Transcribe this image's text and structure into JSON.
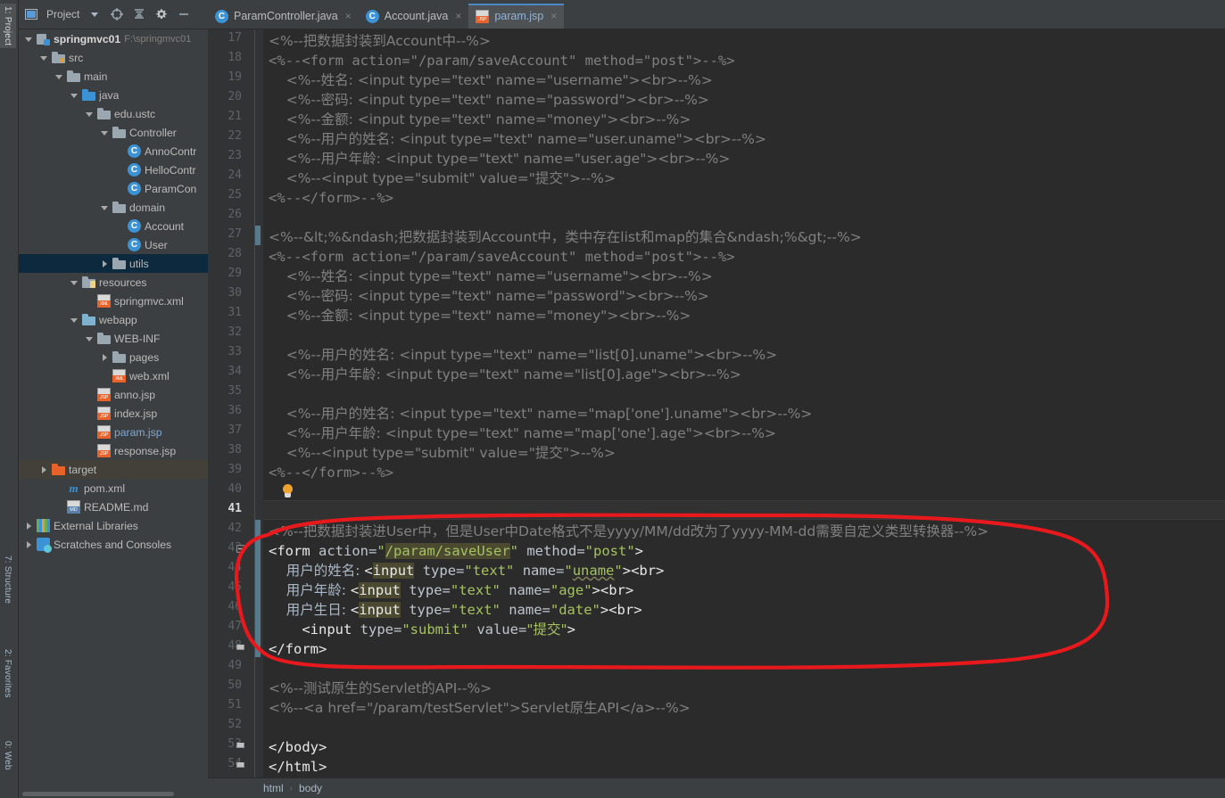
{
  "toolstrip": {
    "items": [
      {
        "label": "1: Project",
        "active": true
      },
      {
        "label": "7: Structure",
        "active": false
      },
      {
        "label": "2: Favorites",
        "active": false
      },
      {
        "label": "0: Web",
        "active": false
      }
    ]
  },
  "project_toolbar": {
    "title": "Project",
    "icons": [
      "chevron-down-icon",
      "locate-target-icon",
      "collapse-all-icon",
      "settings-gear-icon",
      "minimize-icon"
    ]
  },
  "tabs": [
    {
      "label": "ParamController.java",
      "icon": "java-class-icon",
      "active": false,
      "close": "×"
    },
    {
      "label": "Account.java",
      "icon": "java-class-icon",
      "active": false,
      "close": "×"
    },
    {
      "label": "param.jsp",
      "icon": "jsp-file-icon",
      "active": true,
      "close": "×"
    }
  ],
  "tree": [
    {
      "indent": 0,
      "arrow": "down",
      "icon": "module-icon",
      "label": "springmvc01",
      "bold": true,
      "suffix": "F:\\springmvc01",
      "selected": ""
    },
    {
      "indent": 1,
      "arrow": "down",
      "icon": "folder-src",
      "label": "src",
      "bold": false,
      "suffix": "",
      "selected": ""
    },
    {
      "indent": 2,
      "arrow": "down",
      "icon": "folder",
      "label": "main",
      "bold": false,
      "suffix": "",
      "selected": ""
    },
    {
      "indent": 3,
      "arrow": "down",
      "icon": "folder-blue",
      "label": "java",
      "bold": false,
      "suffix": "",
      "selected": ""
    },
    {
      "indent": 4,
      "arrow": "down",
      "icon": "package-icon",
      "label": "edu.ustc",
      "bold": false,
      "suffix": "",
      "selected": ""
    },
    {
      "indent": 5,
      "arrow": "down",
      "icon": "package-icon",
      "label": "Controller",
      "bold": false,
      "suffix": "",
      "selected": ""
    },
    {
      "indent": 6,
      "arrow": "none",
      "icon": "java-class-icon",
      "label": "AnnoContr",
      "bold": false,
      "suffix": "",
      "selected": ""
    },
    {
      "indent": 6,
      "arrow": "none",
      "icon": "java-class-icon",
      "label": "HelloContr",
      "bold": false,
      "suffix": "",
      "selected": ""
    },
    {
      "indent": 6,
      "arrow": "none",
      "icon": "java-class-icon",
      "label": "ParamCon",
      "bold": false,
      "suffix": "",
      "selected": ""
    },
    {
      "indent": 5,
      "arrow": "down",
      "icon": "package-icon",
      "label": "domain",
      "bold": false,
      "suffix": "",
      "selected": ""
    },
    {
      "indent": 6,
      "arrow": "none",
      "icon": "java-class-icon",
      "label": "Account",
      "bold": false,
      "suffix": "",
      "selected": ""
    },
    {
      "indent": 6,
      "arrow": "none",
      "icon": "java-class-icon",
      "label": "User",
      "bold": false,
      "suffix": "",
      "selected": ""
    },
    {
      "indent": 5,
      "arrow": "right",
      "icon": "package-icon",
      "label": "utils",
      "bold": false,
      "suffix": "",
      "selected": "blue"
    },
    {
      "indent": 3,
      "arrow": "down",
      "icon": "folder-res",
      "label": "resources",
      "bold": false,
      "suffix": "",
      "selected": ""
    },
    {
      "indent": 4,
      "arrow": "none",
      "icon": "xml-file-icon",
      "label": "springmvc.xml",
      "bold": false,
      "suffix": "",
      "selected": ""
    },
    {
      "indent": 3,
      "arrow": "down",
      "icon": "folder-web",
      "label": "webapp",
      "bold": false,
      "suffix": "",
      "selected": ""
    },
    {
      "indent": 4,
      "arrow": "down",
      "icon": "folder",
      "label": "WEB-INF",
      "bold": false,
      "suffix": "",
      "selected": ""
    },
    {
      "indent": 5,
      "arrow": "right",
      "icon": "folder",
      "label": "pages",
      "bold": false,
      "suffix": "",
      "selected": ""
    },
    {
      "indent": 5,
      "arrow": "none",
      "icon": "xml-file-icon",
      "label": "web.xml",
      "bold": false,
      "suffix": "",
      "selected": ""
    },
    {
      "indent": 4,
      "arrow": "none",
      "icon": "jsp-file-icon",
      "label": "anno.jsp",
      "bold": false,
      "suffix": "",
      "selected": ""
    },
    {
      "indent": 4,
      "arrow": "none",
      "icon": "jsp-file-icon",
      "label": "index.jsp",
      "bold": false,
      "suffix": "",
      "selected": ""
    },
    {
      "indent": 4,
      "arrow": "none",
      "icon": "jsp-file-icon",
      "label": "param.jsp",
      "bold": false,
      "suffix": "",
      "selected": "",
      "highlight": true
    },
    {
      "indent": 4,
      "arrow": "none",
      "icon": "jsp-file-icon",
      "label": "response.jsp",
      "bold": false,
      "suffix": "",
      "selected": ""
    },
    {
      "indent": 1,
      "arrow": "right",
      "icon": "folder-orange",
      "label": "target",
      "bold": false,
      "suffix": "",
      "selected": "brown"
    },
    {
      "indent": 2,
      "arrow": "none",
      "icon": "maven-icon",
      "label": "pom.xml",
      "bold": false,
      "suffix": "",
      "selected": ""
    },
    {
      "indent": 2,
      "arrow": "none",
      "icon": "md-file-icon",
      "label": "README.md",
      "bold": false,
      "suffix": "",
      "selected": ""
    },
    {
      "indent": 0,
      "arrow": "right",
      "icon": "library-icon",
      "label": "External Libraries",
      "bold": false,
      "suffix": "",
      "selected": ""
    },
    {
      "indent": 0,
      "arrow": "right",
      "icon": "scratch-icon",
      "label": "Scratches and Consoles",
      "bold": false,
      "suffix": "",
      "selected": ""
    }
  ],
  "editor": {
    "first_line": 17,
    "current_line": 41,
    "line_height": 22,
    "gutter_bulb_line": 40,
    "vcs_change_lines": [
      27,
      42,
      43,
      44,
      45,
      46,
      47,
      48
    ],
    "fold_lines": [
      43,
      48,
      53,
      54
    ],
    "lines": [
      {
        "n": 17,
        "segments": [
          {
            "t": "<%--把数据封装到Account中--%>",
            "c": "cmt"
          }
        ]
      },
      {
        "n": 18,
        "segments": [
          {
            "t": "<%--<form action=\"/param/saveAccount\" method=\"post\">--%>",
            "c": "cmt"
          }
        ]
      },
      {
        "n": 19,
        "segments": [
          {
            "t": "    <%--姓名: <input type=\"text\" name=\"username\"><br>--%>",
            "c": "cmt"
          }
        ]
      },
      {
        "n": 20,
        "segments": [
          {
            "t": "    <%--密码: <input type=\"text\" name=\"password\"><br>--%>",
            "c": "cmt"
          }
        ]
      },
      {
        "n": 21,
        "segments": [
          {
            "t": "    <%--金额: <input type=\"text\" name=\"money\"><br>--%>",
            "c": "cmt"
          }
        ]
      },
      {
        "n": 22,
        "segments": [
          {
            "t": "    <%--用户的姓名: <input type=\"text\" name=\"user.uname\"><br>--%>",
            "c": "cmt"
          }
        ]
      },
      {
        "n": 23,
        "segments": [
          {
            "t": "    <%--用户年龄: <input type=\"text\" name=\"user.age\"><br>--%>",
            "c": "cmt"
          }
        ]
      },
      {
        "n": 24,
        "segments": [
          {
            "t": "    <%--<input type=\"submit\" value=\"提交\">--%>",
            "c": "cmt"
          }
        ]
      },
      {
        "n": 25,
        "segments": [
          {
            "t": "<%--</form>--%>",
            "c": "cmt"
          }
        ]
      },
      {
        "n": 26,
        "segments": []
      },
      {
        "n": 27,
        "segments": [
          {
            "t": "<%--&lt;%&ndash;把数据封装到Account中，类中存在list和map的集合&ndash;%&gt;--%>",
            "c": "cmt"
          }
        ]
      },
      {
        "n": 28,
        "segments": [
          {
            "t": "<%--<form action=\"/param/saveAccount\" method=\"post\">--%>",
            "c": "cmt"
          }
        ]
      },
      {
        "n": 29,
        "segments": [
          {
            "t": "    <%--姓名: <input type=\"text\" name=\"username\"><br>--%>",
            "c": "cmt"
          }
        ]
      },
      {
        "n": 30,
        "segments": [
          {
            "t": "    <%--密码: <input type=\"text\" name=\"password\"><br>--%>",
            "c": "cmt"
          }
        ]
      },
      {
        "n": 31,
        "segments": [
          {
            "t": "    <%--金额: <input type=\"text\" name=\"money\"><br>--%>",
            "c": "cmt"
          }
        ]
      },
      {
        "n": 32,
        "segments": []
      },
      {
        "n": 33,
        "segments": [
          {
            "t": "    <%--用户的姓名: <input type=\"text\" name=\"list[0].uname\"><br>--%>",
            "c": "cmt"
          }
        ]
      },
      {
        "n": 34,
        "segments": [
          {
            "t": "    <%--用户年龄: <input type=\"text\" name=\"list[0].age\"><br>--%>",
            "c": "cmt"
          }
        ]
      },
      {
        "n": 35,
        "segments": []
      },
      {
        "n": 36,
        "segments": [
          {
            "t": "    <%--用户的姓名: <input type=\"text\" name=\"map['one'].uname\"><br>--%>",
            "c": "cmt"
          }
        ]
      },
      {
        "n": 37,
        "segments": [
          {
            "t": "    <%--用户年龄: <input type=\"text\" name=\"map['one'].age\"><br>--%>",
            "c": "cmt"
          }
        ]
      },
      {
        "n": 38,
        "segments": [
          {
            "t": "    <%--<input type=\"submit\" value=\"提交\">--%>",
            "c": "cmt"
          }
        ]
      },
      {
        "n": 39,
        "segments": [
          {
            "t": "<%--</form>--%>",
            "c": "cmt"
          }
        ]
      },
      {
        "n": 40,
        "segments": []
      },
      {
        "n": 41,
        "segments": []
      },
      {
        "n": 42,
        "segments": [
          {
            "t": "<%--把数据封装进User中，但是User中Date格式不是yyyy/MM/dd改为了yyyy-MM-dd需要自定义类型转换器--%>",
            "c": "cmt"
          }
        ]
      },
      {
        "n": 43,
        "segments": [
          {
            "t": "<form",
            "c": "tag"
          },
          {
            "t": " action=",
            "c": "attr"
          },
          {
            "t": "\"",
            "c": "str"
          },
          {
            "t": "/param/saveUser",
            "c": "strhl"
          },
          {
            "t": "\"",
            "c": "str"
          },
          {
            "t": " method=",
            "c": "attr"
          },
          {
            "t": "\"post\"",
            "c": "str"
          },
          {
            "t": ">",
            "c": "tag"
          }
        ]
      },
      {
        "n": 44,
        "segments": [
          {
            "t": "    用户的姓名: ",
            "c": "plain"
          },
          {
            "t": "<",
            "c": "tag"
          },
          {
            "t": "input",
            "c": "taghl"
          },
          {
            "t": " type=",
            "c": "attr"
          },
          {
            "t": "\"text\"",
            "c": "str"
          },
          {
            "t": " name=",
            "c": "attr"
          },
          {
            "t": "\"",
            "c": "str"
          },
          {
            "t": "uname",
            "c": "strwave"
          },
          {
            "t": "\"",
            "c": "str"
          },
          {
            "t": "><br>",
            "c": "tag"
          }
        ]
      },
      {
        "n": 45,
        "segments": [
          {
            "t": "    用户年龄: ",
            "c": "plain"
          },
          {
            "t": "<",
            "c": "tag"
          },
          {
            "t": "input",
            "c": "taghl"
          },
          {
            "t": " type=",
            "c": "attr"
          },
          {
            "t": "\"text\"",
            "c": "str"
          },
          {
            "t": " name=",
            "c": "attr"
          },
          {
            "t": "\"age\"",
            "c": "str"
          },
          {
            "t": "><br>",
            "c": "tag"
          }
        ]
      },
      {
        "n": 46,
        "segments": [
          {
            "t": "    用户生日: ",
            "c": "plain"
          },
          {
            "t": "<",
            "c": "tag"
          },
          {
            "t": "input",
            "c": "taghl"
          },
          {
            "t": " type=",
            "c": "attr"
          },
          {
            "t": "\"text\"",
            "c": "str"
          },
          {
            "t": " name=",
            "c": "attr"
          },
          {
            "t": "\"date\"",
            "c": "str"
          },
          {
            "t": "><br>",
            "c": "tag"
          }
        ]
      },
      {
        "n": 47,
        "segments": [
          {
            "t": "    <input",
            "c": "tag"
          },
          {
            "t": " type=",
            "c": "attr"
          },
          {
            "t": "\"submit\"",
            "c": "str"
          },
          {
            "t": " value=",
            "c": "attr"
          },
          {
            "t": "\"提交\"",
            "c": "str"
          },
          {
            "t": ">",
            "c": "tag"
          }
        ]
      },
      {
        "n": 48,
        "segments": [
          {
            "t": "</form>",
            "c": "tag"
          }
        ]
      },
      {
        "n": 49,
        "segments": []
      },
      {
        "n": 50,
        "segments": [
          {
            "t": "<%--测试原生的Servlet的API--%>",
            "c": "cmt"
          }
        ]
      },
      {
        "n": 51,
        "segments": [
          {
            "t": "<%--<a href=\"/param/testServlet\">Servlet原生API</a>--%>",
            "c": "cmt"
          }
        ]
      },
      {
        "n": 52,
        "segments": []
      },
      {
        "n": 53,
        "segments": [
          {
            "t": "</body>",
            "c": "tag"
          }
        ]
      },
      {
        "n": 54,
        "segments": [
          {
            "t": "</html>",
            "c": "tag"
          }
        ]
      }
    ]
  },
  "breadcrumb": {
    "items": [
      "html",
      "body"
    ],
    "separator": "›"
  },
  "annotation": {
    "type": "hand-drawn-ellipse",
    "color": "#e8191c",
    "covers_lines": "42-48",
    "stroke_width": 4
  },
  "colors": {
    "editor_bg": "#2b2b2b",
    "panel_bg": "#3c3f41",
    "gutter_bg": "#313335",
    "accent_blue": "#4a88c7",
    "comment_gray": "#808080",
    "string_green": "#a5c261",
    "caret_highlight": "#4b4a31",
    "selection_blue": "#0d293e",
    "annotation_red": "#e8191c"
  }
}
